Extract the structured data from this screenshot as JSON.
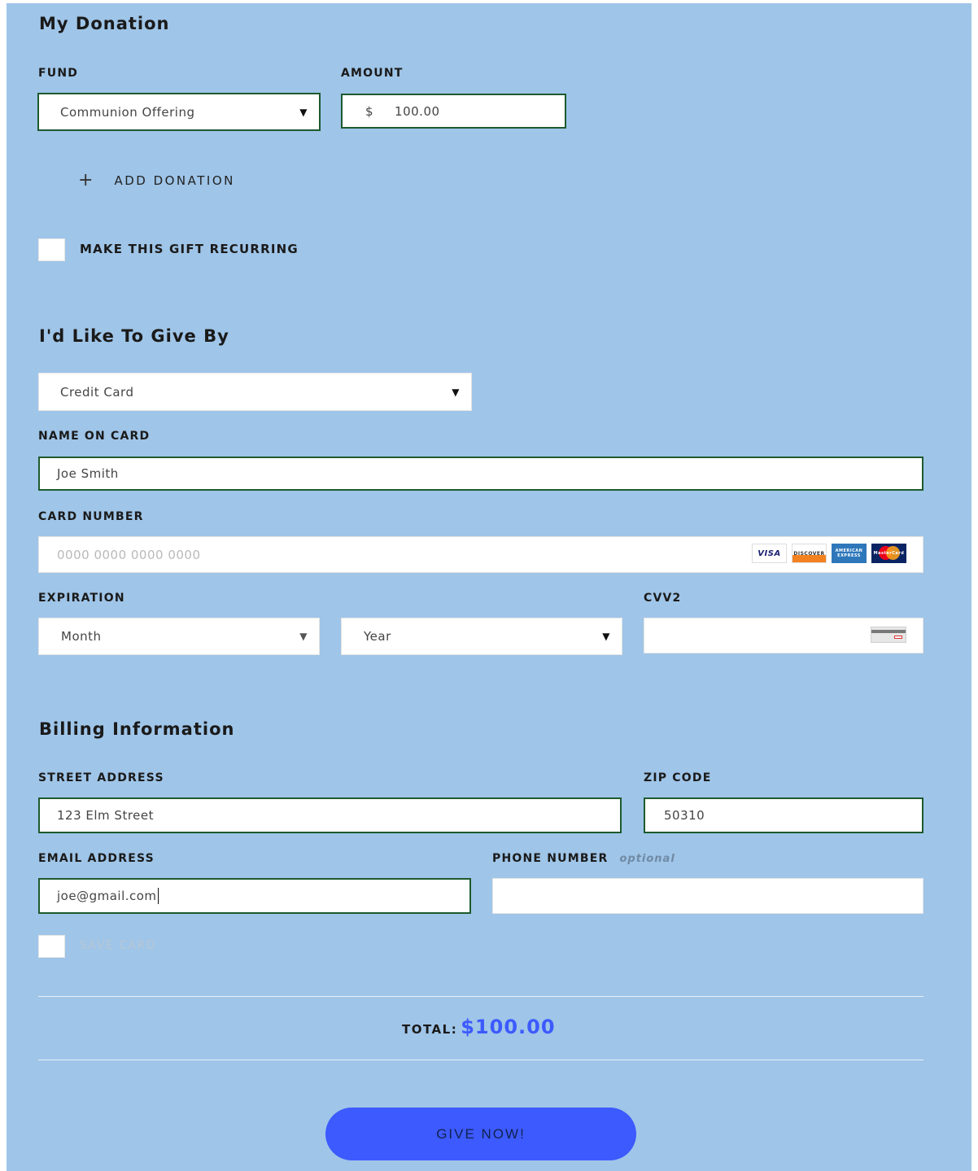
{
  "donation": {
    "heading": "My Donation",
    "fund_label": "FUND",
    "fund_value": "Communion Offering",
    "amount_label": "AMOUNT",
    "currency_symbol": "$",
    "amount_value": "100.00",
    "add_donation_icon": "+",
    "add_donation_label": "ADD DONATION",
    "recurring_label": "MAKE THIS GIFT RECURRING"
  },
  "give_by": {
    "heading": "I'd Like To Give By",
    "method_value": "Credit Card",
    "name_label": "NAME ON CARD",
    "name_value": "Joe Smith",
    "card_label": "CARD NUMBER",
    "card_placeholder": "0000 0000 0000 0000",
    "card_logos": [
      "VISA",
      "DISCOVER",
      "AMERICAN EXPRESS",
      "MasterCard"
    ],
    "expiration_label": "EXPIRATION",
    "month_value": "Month",
    "year_value": "Year",
    "cvv_label": "CVV2"
  },
  "billing": {
    "heading": "Billing Information",
    "street_label": "STREET ADDRESS",
    "street_value": "123 Elm Street",
    "zip_label": "ZIP CODE",
    "zip_value": "50310",
    "email_label": "EMAIL ADDRESS",
    "email_value": "joe@gmail.com",
    "phone_label": "PHONE NUMBER",
    "phone_optional": "optional",
    "phone_value": "",
    "save_card_label": "SAVE CARD"
  },
  "total": {
    "label": "TOTAL:",
    "value": "$100.00"
  },
  "submit": {
    "label": "GIVE NOW!"
  },
  "colors": {
    "background": "#9fc5e8",
    "accent": "#3d5afe",
    "field_border_active": "#1e5a2e"
  }
}
